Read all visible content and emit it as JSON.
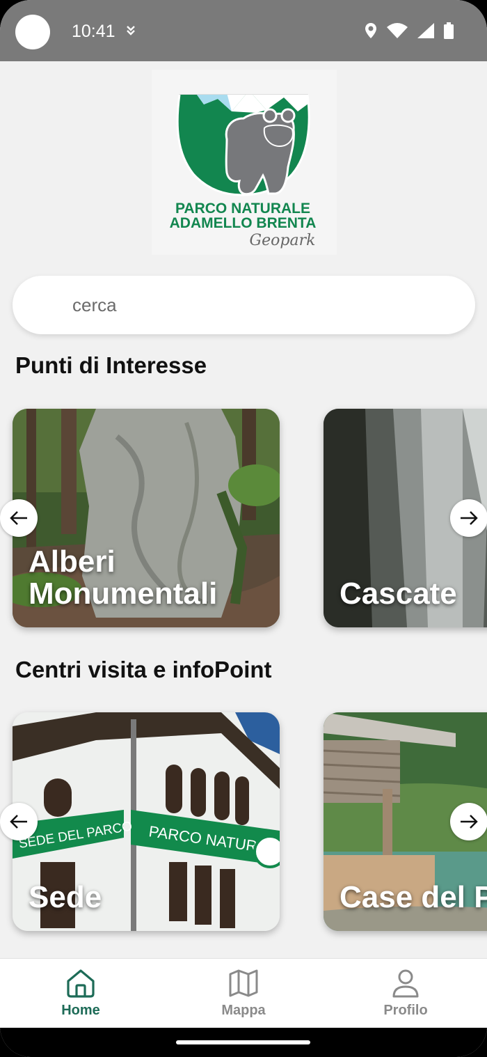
{
  "status_bar": {
    "time": "10:41",
    "icons": [
      "download-icon",
      "location-icon",
      "wifi-icon",
      "signal-icon",
      "battery-icon"
    ]
  },
  "logo": {
    "line1": "PARCO NATURALE",
    "line2": "ADAMELLO BRENTA",
    "line3": "Geopark",
    "colors": {
      "green": "#12864f",
      "sky": "#a9dcef",
      "bear": "#77787b"
    }
  },
  "search": {
    "placeholder": "cerca",
    "value": ""
  },
  "sections": [
    {
      "title": "Punti di Interesse",
      "cards": [
        {
          "label_line1": "Alberi",
          "label_line2": "Monumentali"
        },
        {
          "label": "Cascate"
        }
      ]
    },
    {
      "title": "Centri visita e infoPoint",
      "cards": [
        {
          "label": "Sede"
        },
        {
          "label": "Case del P"
        }
      ]
    }
  ],
  "photo_signage": {
    "sede_sign": "SEDE DEL PARCO",
    "parco_sign": "PARCO NATURALE"
  },
  "nav": {
    "items": [
      {
        "label": "Home",
        "icon": "home-icon",
        "active": true
      },
      {
        "label": "Mappa",
        "icon": "map-icon",
        "active": false
      },
      {
        "label": "Profilo",
        "icon": "profile-icon",
        "active": false
      }
    ],
    "active_color": "#1d6b57",
    "inactive_color": "#8a8a8a"
  }
}
